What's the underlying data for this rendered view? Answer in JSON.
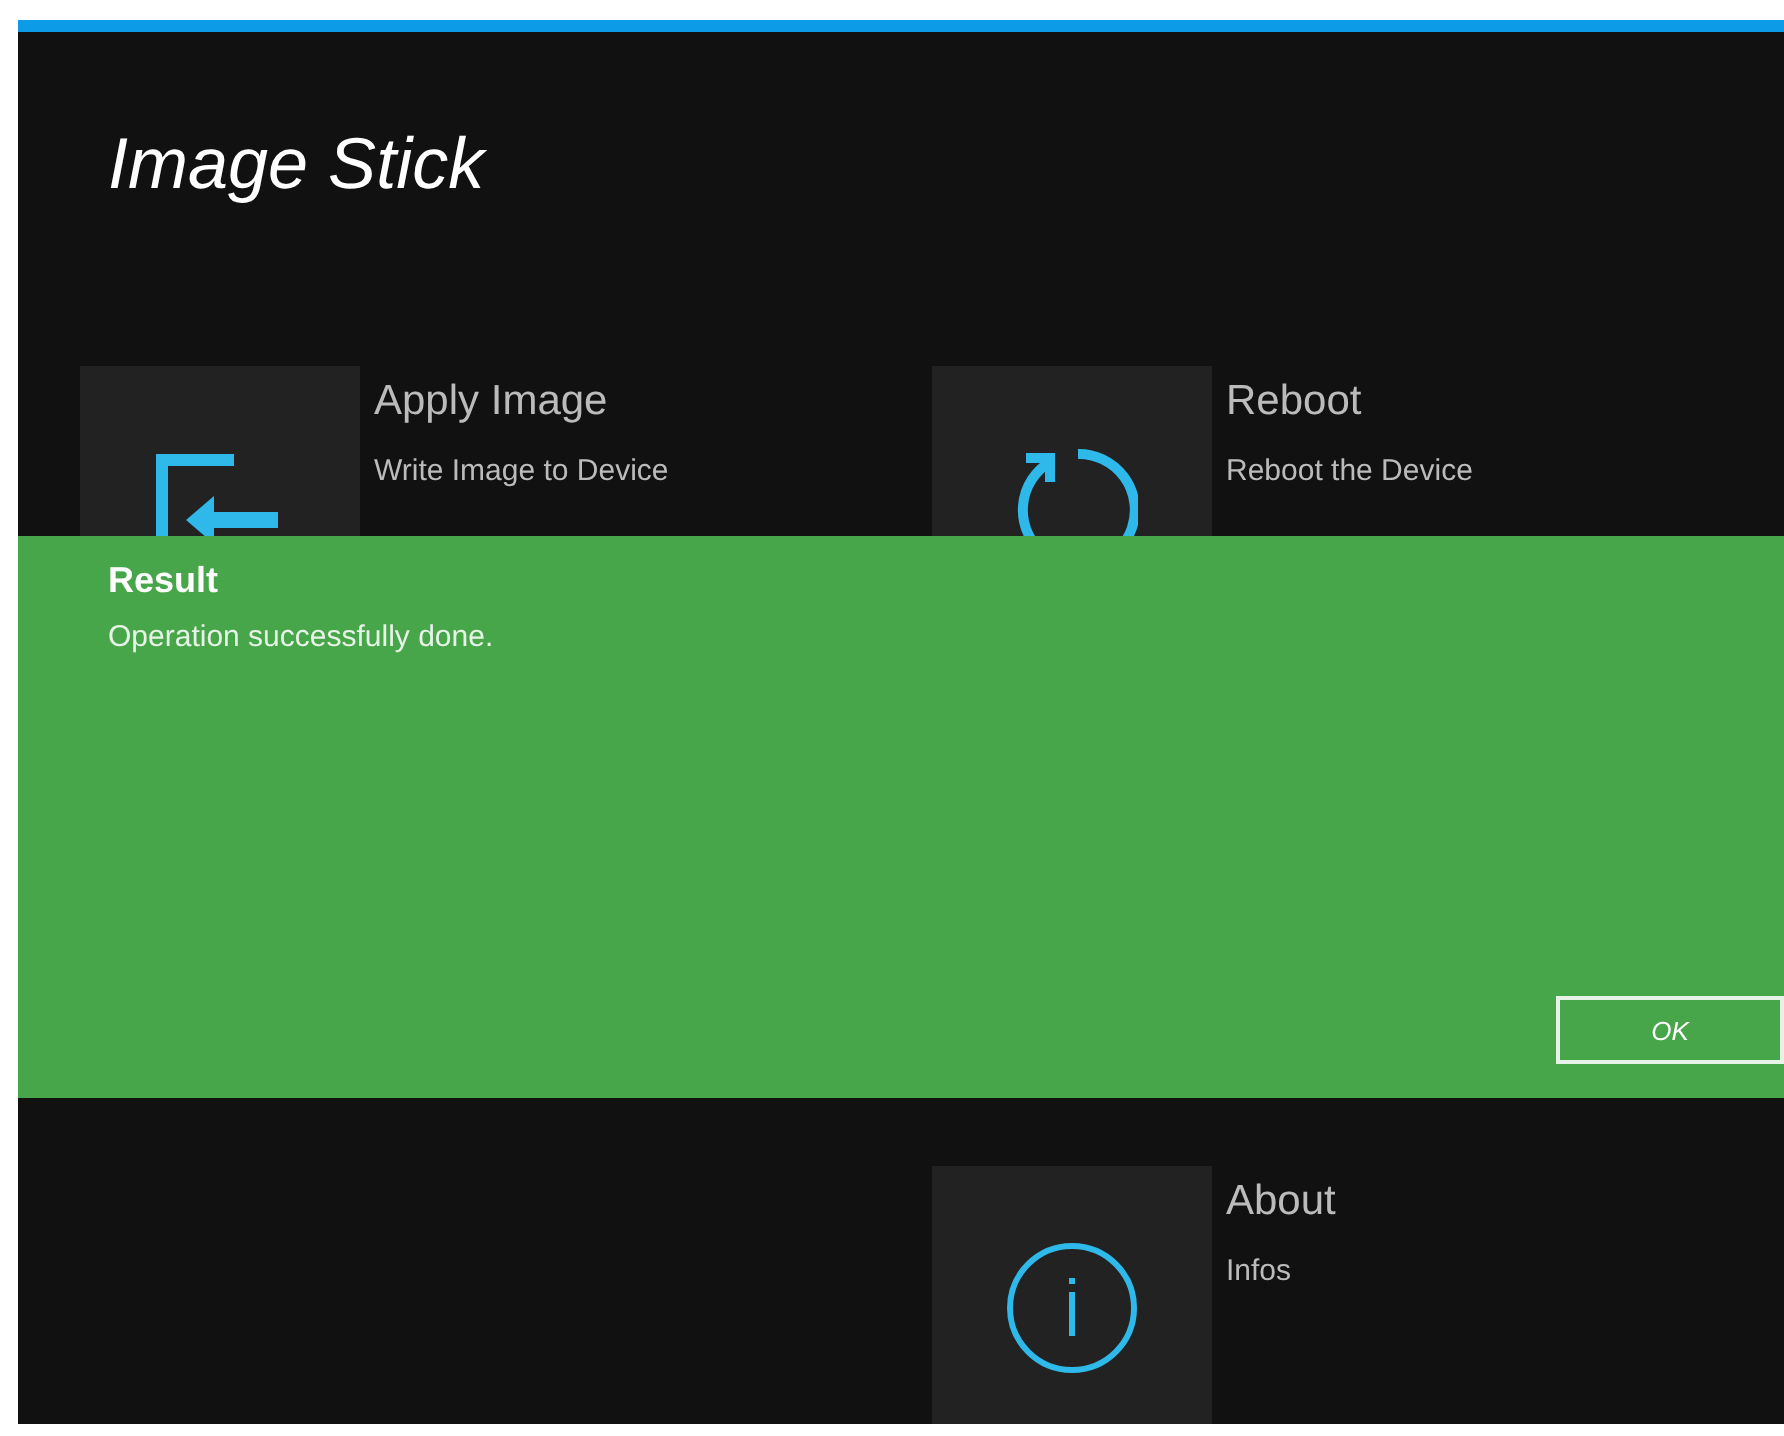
{
  "app": {
    "title": "Image Stick"
  },
  "tile_rows": [
    {
      "left": {
        "kind": "apply",
        "title": "Apply Image",
        "subtitle": "Write Image to Device"
      },
      "right": {
        "kind": "reboot",
        "title": "Reboot",
        "subtitle": "Reboot the Device"
      }
    },
    {
      "right": {
        "kind": "info",
        "title": "About",
        "subtitle": "Infos"
      }
    }
  ],
  "dialog": {
    "title": "Result",
    "message": "Operation successfully done.",
    "buttons": [
      "OK"
    ]
  }
}
